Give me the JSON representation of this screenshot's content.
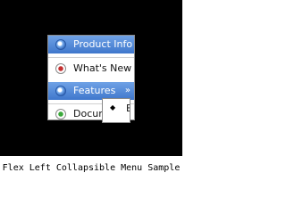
{
  "menu": {
    "items": [
      {
        "label": "Product Info",
        "state": "active",
        "icon": "radio-blue-icon"
      },
      {
        "label": "What's New",
        "state": "normal",
        "icon": "radio-red-icon"
      },
      {
        "label": "Features",
        "state": "active",
        "icon": "radio-blue-icon",
        "arrow": "»"
      },
      {
        "label": "Docum",
        "state": "normal",
        "icon": "radio-green-icon"
      }
    ]
  },
  "submenu": {
    "bullet": "◆",
    "label": "Ea"
  },
  "caption": "Flex Left Collapsible Menu Sample",
  "colors": {
    "active_bg": "#4a80d6",
    "frame_bg": "#000000"
  }
}
